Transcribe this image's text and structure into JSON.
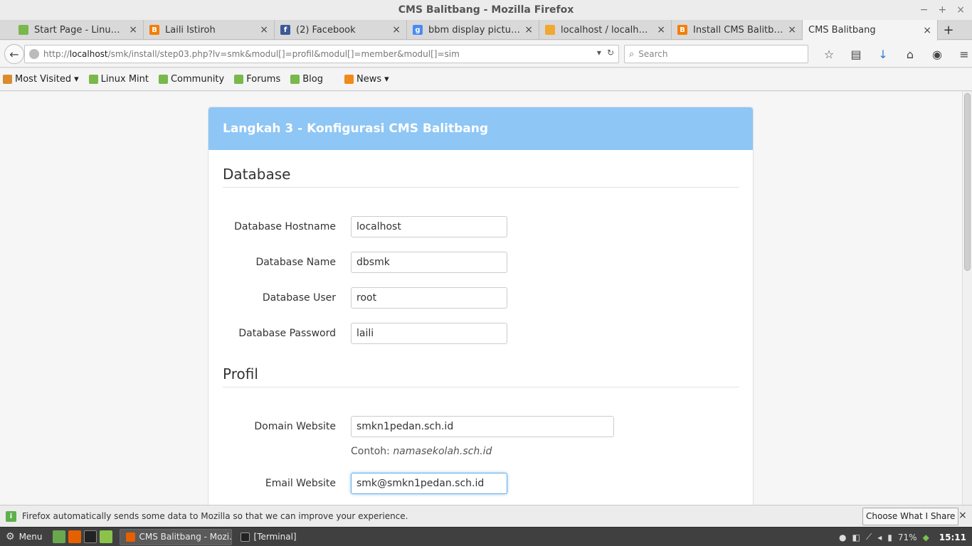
{
  "window": {
    "title": "CMS Balitbang - Mozilla Firefox",
    "min_icon": "−",
    "max_icon": "+",
    "close_icon": "×"
  },
  "tabs": [
    {
      "label": "Start Page - Linux Mint",
      "icon": "linux-mint-icon",
      "color": "#79b84a"
    },
    {
      "label": "Laili Istiroh",
      "icon": "blogger-icon",
      "color": "#f57d00"
    },
    {
      "label": "(2) Facebook",
      "icon": "facebook-icon",
      "color": "#3b5998"
    },
    {
      "label": "bbm display picture l...",
      "icon": "google-icon",
      "color": "#4a8af4"
    },
    {
      "label": "localhost / localhost ...",
      "icon": "phpmyadmin-icon",
      "color": "#f0a830"
    },
    {
      "label": "Install CMS Balitban...",
      "icon": "blogger-icon",
      "color": "#f57d00"
    },
    {
      "label": "CMS Balitbang",
      "icon": "",
      "color": ""
    }
  ],
  "tab_close": "×",
  "new_tab": "+",
  "nav": {
    "back": "←",
    "url_prefix": "http://",
    "url_host": "localhost",
    "url_path": "/smk/install/step03.php?lv=smk&modul[]=profil&modul[]=member&modul[]=sim",
    "url_dropdown": "▾",
    "reload": "↻",
    "search_placeholder": "Search",
    "search_icon": "⌕"
  },
  "nav_icons": [
    {
      "name": "bookmark-star-icon",
      "glyph": "☆"
    },
    {
      "name": "reader-list-icon",
      "glyph": "▤"
    },
    {
      "name": "download-icon",
      "glyph": "↓"
    },
    {
      "name": "home-icon",
      "glyph": "⌂"
    },
    {
      "name": "chat-icon",
      "glyph": "◉"
    },
    {
      "name": "hamburger-menu-icon",
      "glyph": "≡"
    }
  ],
  "bookmarks": [
    {
      "label": "Most Visited",
      "arrow": "▾",
      "type": "folder"
    },
    {
      "label": "Linux Mint",
      "arrow": "",
      "type": "mint"
    },
    {
      "label": "Community",
      "arrow": "",
      "type": "mint"
    },
    {
      "label": "Forums",
      "arrow": "",
      "type": "mint"
    },
    {
      "label": "Blog",
      "arrow": "",
      "type": "mint"
    },
    {
      "label": "News",
      "arrow": "▾",
      "type": "rss"
    }
  ],
  "panel": {
    "heading": "Langkah 3 - Konfigurasi CMS Balitbang",
    "accent": "#8ec6f5"
  },
  "database": {
    "title": "Database",
    "fields": [
      {
        "label": "Database Hostname",
        "value": "localhost"
      },
      {
        "label": "Database Name",
        "value": "dbsmk"
      },
      {
        "label": "Database User",
        "value": "root"
      },
      {
        "label": "Database Password",
        "value": "laili"
      }
    ]
  },
  "profil": {
    "title": "Profil",
    "domain_label": "Domain Website",
    "domain_value": "smkn1pedan.sch.id",
    "hint_prefix": "Contoh: ",
    "hint_example": "namasekolah.sch.id",
    "email_label": "Email Website",
    "email_value": "smk@smkn1pedan.sch.id"
  },
  "notification": {
    "text": "Firefox automatically sends some data to Mozilla so that we can improve your experience.",
    "button": "Choose What I Share",
    "close": "×"
  },
  "taskbar": {
    "menu_label": "Menu",
    "menu_glyph": "⚙",
    "tasks": [
      {
        "label": "CMS Balitbang - Mozi...",
        "color": "#e66000"
      },
      {
        "label": "[Terminal]",
        "color": "#222"
      }
    ],
    "battery": "71%",
    "clock": "15:11"
  }
}
